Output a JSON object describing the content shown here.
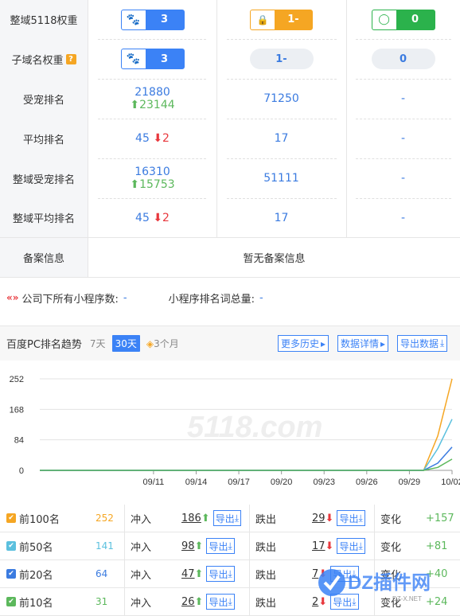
{
  "rows": [
    {
      "label": "整域5118权重",
      "c1": {
        "type": "badge-blue",
        "icon": "paw-icon",
        "value": "3"
      },
      "c2": {
        "type": "badge-orange",
        "icon": "lock-icon",
        "value": "1-"
      },
      "c3": {
        "type": "badge-green",
        "icon": "ring-icon",
        "value": "0"
      }
    },
    {
      "label": "子域名权重",
      "help": "?",
      "c1": {
        "type": "badge-blue",
        "icon": "paw-icon",
        "value": "3"
      },
      "c2": {
        "type": "pill",
        "value": "1-"
      },
      "c3": {
        "type": "pill",
        "value": "0"
      }
    },
    {
      "label": "受宠排名",
      "c1": {
        "main": "21880",
        "sub": "23144",
        "dir": "up"
      },
      "c2": {
        "main": "71250"
      },
      "c3": {
        "main": "-"
      }
    },
    {
      "label": "平均排名",
      "c1": {
        "main": "45",
        "delta": "2",
        "dir": "down"
      },
      "c2": {
        "main": "17"
      },
      "c3": {
        "main": "-"
      }
    },
    {
      "label": "整域受宠排名",
      "c1": {
        "main": "16310",
        "sub": "15753",
        "dir": "up"
      },
      "c2": {
        "main": "51111"
      },
      "c3": {
        "main": "-"
      }
    },
    {
      "label": "整域平均排名",
      "c1": {
        "main": "45",
        "delta": "2",
        "dir": "down"
      },
      "c2": {
        "main": "17"
      },
      "c3": {
        "main": "-"
      }
    }
  ],
  "beian": {
    "label": "备案信息",
    "value": "暂无备案信息"
  },
  "mini": {
    "logo": "«»",
    "label1": "公司下所有小程序数:",
    "value1": "-",
    "label2": "小程序排名词总量:",
    "value2": "-"
  },
  "trend": {
    "title": "百度PC排名趋势",
    "ranges": [
      "7天",
      "30天",
      "3个月"
    ],
    "active_range": "30天",
    "buttons": [
      "更多历史",
      "数据详情",
      "导出数据"
    ]
  },
  "chart_data": {
    "type": "line",
    "x": [
      "09/03",
      "09/04",
      "09/05",
      "09/06",
      "09/07",
      "09/08",
      "09/09",
      "09/10",
      "09/11",
      "09/12",
      "09/13",
      "09/14",
      "09/15",
      "09/16",
      "09/17",
      "09/18",
      "09/19",
      "09/20",
      "09/21",
      "09/22",
      "09/23",
      "09/24",
      "09/25",
      "09/26",
      "09/27",
      "09/28",
      "09/29",
      "09/30",
      "10/01",
      "10/02"
    ],
    "xticks": [
      "09/11",
      "09/14",
      "09/17",
      "09/20",
      "09/23",
      "09/26",
      "09/29",
      "10/02"
    ],
    "yticks": [
      "252",
      "168",
      "84",
      "0"
    ],
    "ylim": [
      0,
      252
    ],
    "series": [
      {
        "color": "#f5a623",
        "values": [
          0,
          0,
          0,
          0,
          0,
          0,
          0,
          0,
          0,
          0,
          0,
          0,
          0,
          0,
          0,
          0,
          0,
          0,
          0,
          0,
          0,
          0,
          0,
          0,
          0,
          0,
          0,
          0,
          95,
          252
        ]
      },
      {
        "color": "#5bc0de",
        "values": [
          0,
          0,
          0,
          0,
          0,
          0,
          0,
          0,
          0,
          0,
          0,
          0,
          0,
          0,
          0,
          0,
          0,
          0,
          0,
          0,
          0,
          0,
          0,
          0,
          0,
          0,
          0,
          0,
          60,
          141
        ]
      },
      {
        "color": "#3b7be0",
        "values": [
          0,
          0,
          0,
          0,
          0,
          0,
          0,
          0,
          0,
          0,
          0,
          0,
          0,
          0,
          0,
          0,
          0,
          0,
          0,
          0,
          0,
          0,
          0,
          0,
          0,
          0,
          0,
          0,
          20,
          64
        ]
      },
      {
        "color": "#5cb85c",
        "values": [
          0,
          0,
          0,
          0,
          0,
          0,
          0,
          0,
          0,
          0,
          0,
          0,
          0,
          0,
          0,
          0,
          0,
          0,
          0,
          0,
          0,
          0,
          0,
          0,
          0,
          0,
          0,
          0,
          8,
          31
        ]
      }
    ],
    "watermark": "5118.com"
  },
  "stats": [
    {
      "name": "前100名",
      "count": "252",
      "color": "#f5a623",
      "in": "186",
      "out": "29",
      "change": "+157"
    },
    {
      "name": "前50名",
      "count": "141",
      "color": "#5bc0de",
      "in": "98",
      "out": "17",
      "change": "+81"
    },
    {
      "name": "前20名",
      "count": "64",
      "color": "#3b7be0",
      "in": "47",
      "out": "7",
      "change": "+40"
    },
    {
      "name": "前10名",
      "count": "31",
      "color": "#5cb85c",
      "in": "26",
      "out": "2",
      "change": "+24"
    }
  ],
  "stat_labels": {
    "in": "冲入",
    "out": "跌出",
    "change": "变化",
    "export": "导出"
  },
  "watermark2": {
    "brand": "DZ插件网",
    "url": "DZ-X.NET"
  }
}
